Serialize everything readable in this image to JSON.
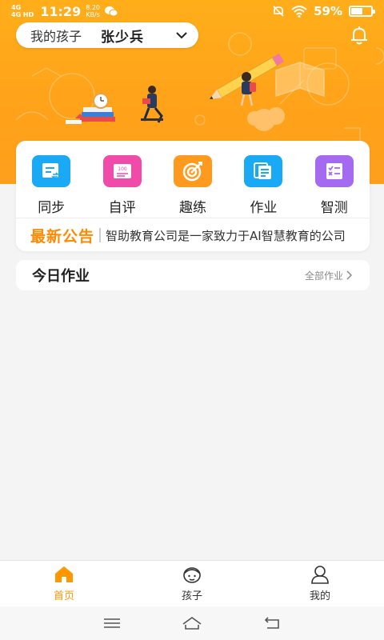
{
  "status_bar": {
    "signal_1": "4G",
    "signal_2": "4G HD",
    "time": "11:29",
    "net_speed": "8.20",
    "net_unit": "KB/s",
    "battery_percent": "59%",
    "battery_level": 0.59,
    "icons": [
      "signal-icon",
      "wechat-icon",
      "mute-icon",
      "wifi-icon",
      "battery-icon"
    ]
  },
  "header": {
    "child_label": "我的孩子",
    "child_name": "张少兵",
    "bell_icon": "bell-icon"
  },
  "features": [
    {
      "label": "同步",
      "icon": "sync-book-icon",
      "color": "#1aa9f5"
    },
    {
      "label": "自评",
      "icon": "self-test-icon",
      "color": "#f04ba8"
    },
    {
      "label": "趣练",
      "icon": "target-icon",
      "color": "#ff9a1f"
    },
    {
      "label": "作业",
      "icon": "homework-icon",
      "color": "#1aa9f5"
    },
    {
      "label": "智测",
      "icon": "smart-test-icon",
      "color": "#a46af0"
    }
  ],
  "notice": {
    "title": "最新公告",
    "text": "智助教育公司是一家致力于AI智慧教育的公司"
  },
  "homework": {
    "title": "今日作业",
    "all_link": "全部作业"
  },
  "tabs": [
    {
      "label": "首页",
      "icon": "home-icon",
      "active": true
    },
    {
      "label": "孩子",
      "icon": "child-face-icon",
      "active": false
    },
    {
      "label": "我的",
      "icon": "profile-icon",
      "active": false
    }
  ],
  "colors": {
    "accent": "#ff9800",
    "banner": "#ffa31a",
    "notice_title": "#ff8a00"
  }
}
